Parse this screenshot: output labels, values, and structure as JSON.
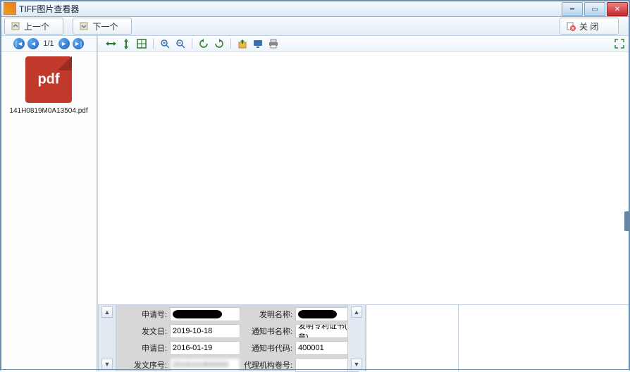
{
  "titlebar": {
    "title": "TIFF图片查看器"
  },
  "toolbar": {
    "prev_label": "上一个",
    "next_label": "下一个",
    "close_label": "关 闭"
  },
  "nav": {
    "page_indicator": "1/1"
  },
  "thumbnail": {
    "badge": "pdf",
    "filename": "141H0819M0A13504.pdf"
  },
  "form": {
    "labels": {
      "application_no": "申请号:",
      "invention_name": "发明名称:",
      "dispatch_date": "发文日:",
      "notice_name": "通知书名称:",
      "application_date": "申请日:",
      "notice_code": "通知书代码:",
      "dispatch_seq": "发文序号:",
      "agency_reg_no": "代理机构卷号:"
    },
    "values": {
      "application_no": "",
      "invention_name": "",
      "dispatch_date": "2019-10-18",
      "notice_name": "发明专利证书(签章)",
      "application_date": "2016-01-19",
      "notice_code": "400001",
      "dispatch_seq": "",
      "agency_reg_no": ""
    }
  }
}
